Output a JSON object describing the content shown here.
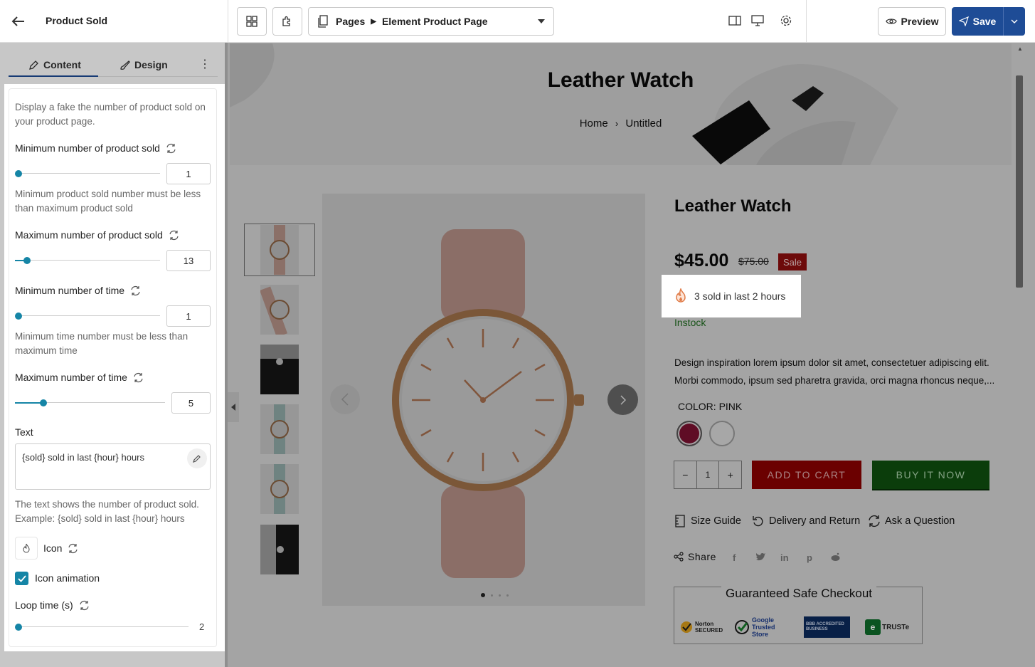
{
  "topbar": {
    "title": "Product Sold",
    "page_crumb_root": "Pages",
    "page_crumb_current": "Element Product Page",
    "preview_label": "Preview",
    "save_label": "Save"
  },
  "panel": {
    "tabs": [
      {
        "label": "Content"
      },
      {
        "label": "Design"
      }
    ],
    "description": "Display a fake the number of product sold on your product page.",
    "min_sold": {
      "label": "Minimum number of product sold",
      "value": "1",
      "hint": "Minimum product sold number must be less than maximum product sold"
    },
    "max_sold": {
      "label": "Maximum number of product sold",
      "value": "13"
    },
    "min_time": {
      "label": "Minimum number of time",
      "value": "1",
      "hint": "Minimum time number must be less than maximum time"
    },
    "max_time": {
      "label": "Maximum number of time",
      "value": "5"
    },
    "text": {
      "label": "Text",
      "value": "{sold} sold in last {hour} hours",
      "hint": "The text shows the number of product sold. Example: {sold} sold in last {hour} hours"
    },
    "icon": {
      "label": "Icon"
    },
    "icon_animation": {
      "label": "Icon animation",
      "checked": true
    },
    "loop_time": {
      "label": "Loop time (s)",
      "value": "2"
    }
  },
  "page": {
    "banner_title": "Leather Watch",
    "breadcrumb_home": "Home",
    "breadcrumb_current": "Untitled",
    "product": {
      "title": "Leather Watch",
      "price": "$45.00",
      "compare_price": "$75.00",
      "sale_badge": "Sale",
      "sold_text": "3 sold in last 2 hours",
      "stock": "Instock",
      "description": "Design inspiration lorem ipsum dolor sit amet, consectetuer adipiscing elit. Morbi commodo, ipsum sed pharetra gravida, orci magna rhoncus neque,...",
      "color_label": "COLOR: PINK",
      "swatches": [
        {
          "color": "#7a1030"
        },
        {
          "color": "#d6d6d6"
        }
      ],
      "quantity": "1",
      "add_to_cart": "ADD TO CART",
      "buy_now": "BUY IT NOW",
      "links": [
        {
          "label": "Size Guide"
        },
        {
          "label": "Delivery and Return"
        },
        {
          "label": "Ask a Question"
        }
      ],
      "share_label": "Share",
      "checkout_title": "Guaranteed Safe Checkout",
      "trust_badges": [
        "Norton SECURED",
        "Google Trusted Store",
        "BBB ACCREDITED BUSINESS",
        "TRUSTe"
      ]
    }
  },
  "colors": {
    "accent": "#1585a6",
    "save": "#1e4c96",
    "sale": "#8c0e0e",
    "cart": "#8a0000",
    "buy": "#0f4f0f",
    "stock": "#1f6b1f"
  }
}
